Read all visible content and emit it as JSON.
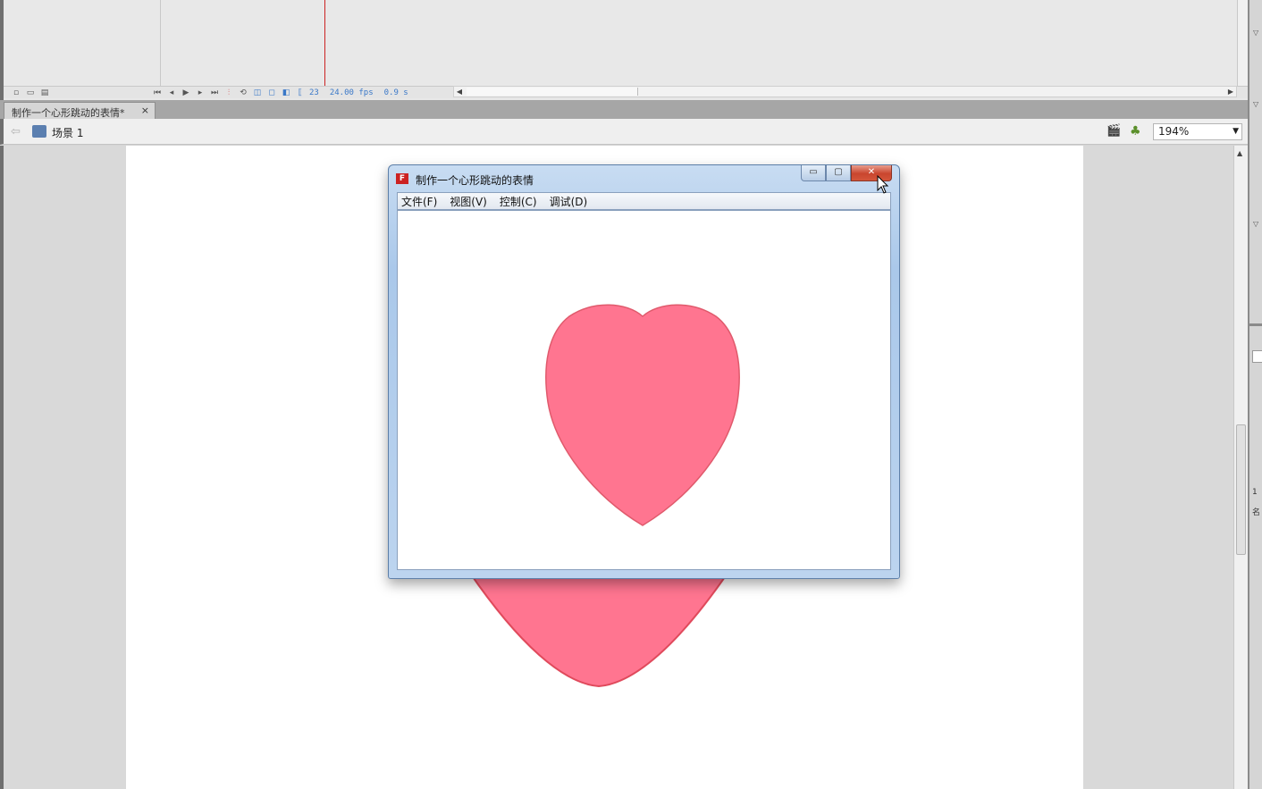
{
  "timeline": {
    "current_frame": "23",
    "fps": "24.00 fps",
    "elapsed": "0.9 s"
  },
  "document_tab": {
    "title": "制作一个心形跳动的表情*",
    "close": "×"
  },
  "edit_bar": {
    "scene": "场景 1",
    "zoom": "194%"
  },
  "player_window": {
    "title": "制作一个心形跳动的表情",
    "menus": [
      "文件(F)",
      "视图(V)",
      "控制(C)",
      "调试(D)"
    ],
    "min_label": "▭",
    "max_label": "▢",
    "close_label": "✕"
  },
  "right_panel": {
    "labels": [
      "1",
      "名"
    ]
  },
  "colors": {
    "heart_fill": "#ff7590",
    "heart_stroke": "#e05a6c",
    "playhead": "#cc2222",
    "close_button": "#c9452e"
  }
}
